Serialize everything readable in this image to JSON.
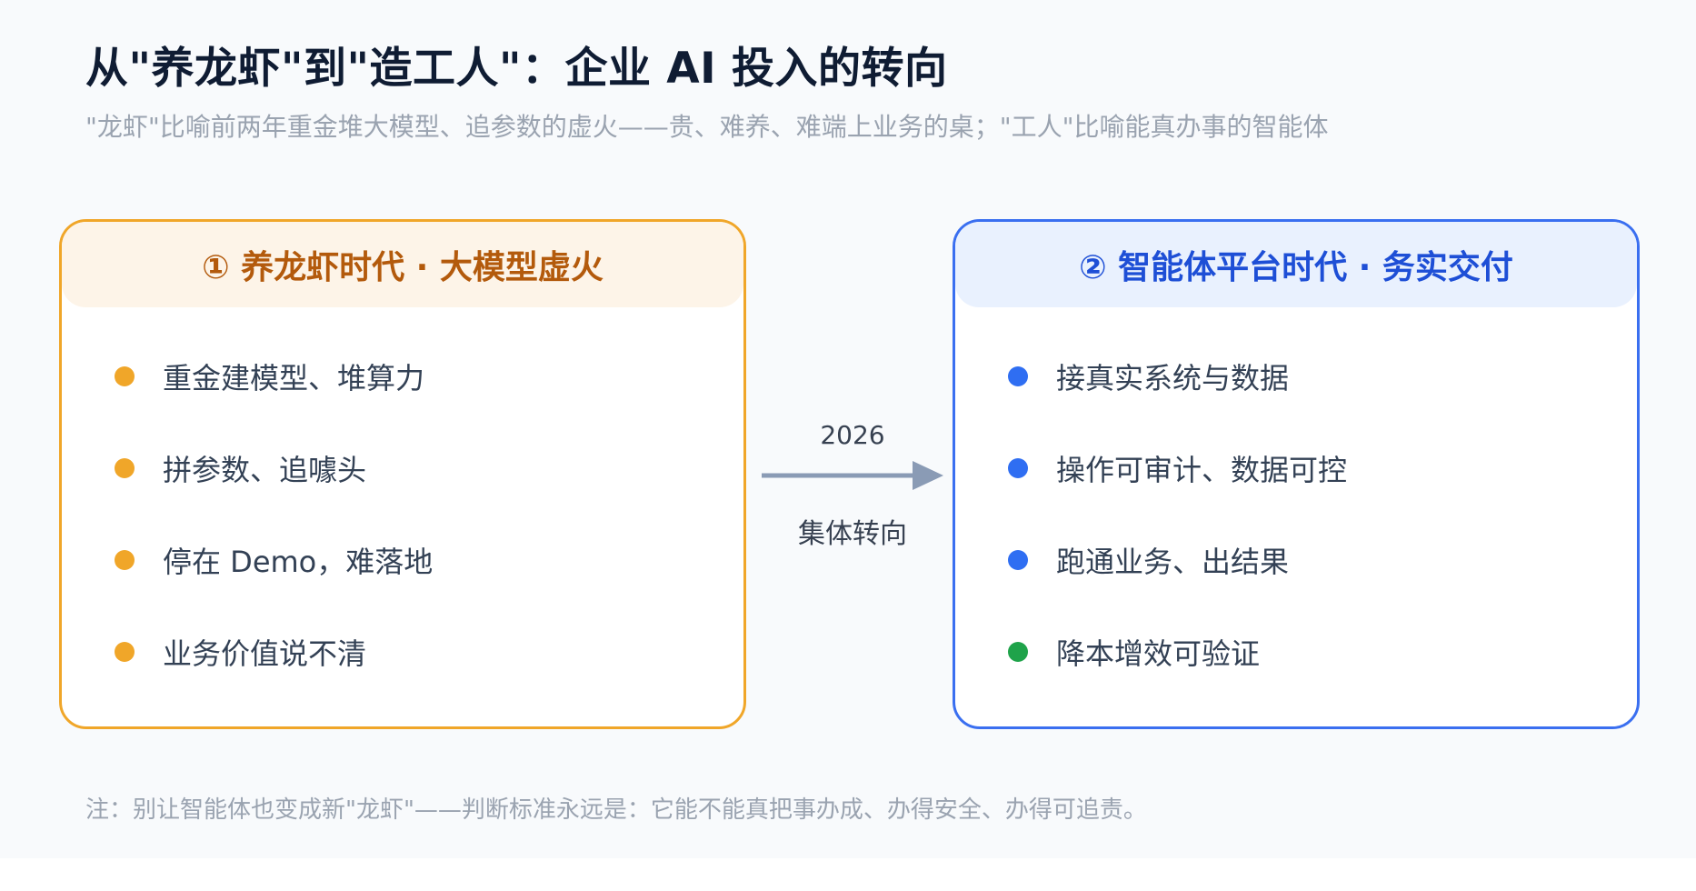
{
  "title": "从\"养龙虾\"到\"造工人\"：企业 AI 投入的转向",
  "subtitle": "\"龙虾\"比喻前两年重金堆大模型、追参数的虚火——贵、难养、难端上业务的桌；\"工人\"比喻能真办事的智能体",
  "left_card": {
    "header": "① 养龙虾时代 · 大模型虚火",
    "items": [
      {
        "text": "重金建模型、堆算力"
      },
      {
        "text": "拼参数、追噱头"
      },
      {
        "text": "停在 Demo，难落地"
      },
      {
        "text": "业务价值说不清"
      }
    ]
  },
  "arrow": {
    "year": "2026",
    "label": "集体转向"
  },
  "right_card": {
    "header": "② 智能体平台时代 · 务实交付",
    "items": [
      {
        "text": "接真实系统与数据"
      },
      {
        "text": "操作可审计、数据可控"
      },
      {
        "text": "跑通业务、出结果"
      },
      {
        "text": "降本增效可验证"
      }
    ]
  },
  "note": "注：别让智能体也变成新\"龙虾\"——判断标准永远是：它能不能真把事办成、办得安全、办得可追责。",
  "colors": {
    "left_accent": "#f0a629",
    "right_accent": "#3a6ff0",
    "green_dot": "#1fa34a",
    "arrow": "#8a9bb5"
  }
}
